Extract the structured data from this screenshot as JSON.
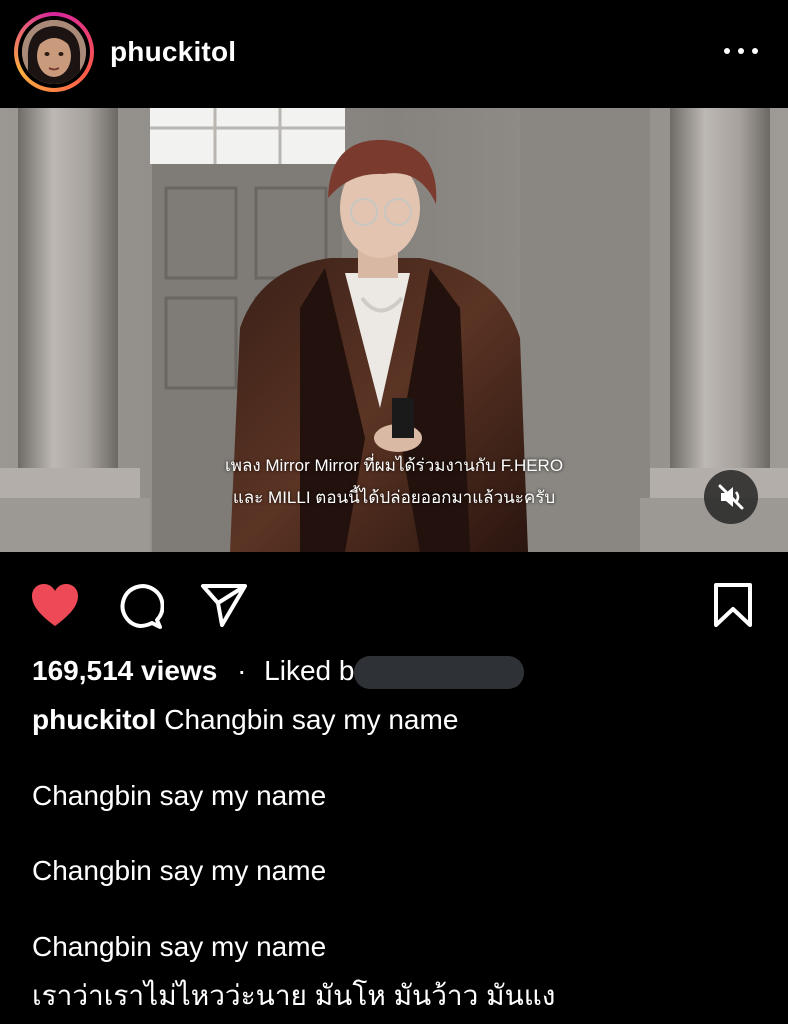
{
  "header": {
    "username": "phuckitol",
    "more_icon": "more-horizontal-icon"
  },
  "video": {
    "subtitle_line1": "เพลง Mirror Mirror ที่ผมได้ร่วมงานกับ F.HERO",
    "subtitle_line2": "และ MILLI ตอนนี้ได้ปล่อยออกมาแล้วนะครับ",
    "mute_icon": "muted-speaker-icon"
  },
  "actions": {
    "like_icon": "heart-filled-icon",
    "like_color": "#ed4956",
    "comment_icon": "comment-icon",
    "share_icon": "send-icon",
    "save_icon": "bookmark-icon"
  },
  "stats": {
    "views": "169,514 views",
    "separator": "·",
    "liked_prefix": "Liked b"
  },
  "caption": {
    "username": "phuckitol",
    "first_line": "Changbin say my name",
    "lines": [
      "Changbin say my name",
      "Changbin say my name",
      "Changbin say my name",
      "เราว่าเราไม่ไหวว่ะนาย มันโห มันว้าว มันแง"
    ]
  }
}
